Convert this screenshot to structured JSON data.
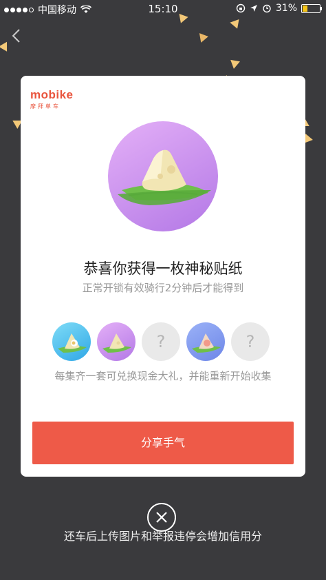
{
  "status_bar": {
    "carrier": "中国移动",
    "time": "15:10",
    "battery": "31%",
    "battery_level": 0.31
  },
  "card": {
    "logo": {
      "brand": "mobike",
      "subtitle": "摩拜单车"
    },
    "title": "恭喜你获得一枚神秘贴纸",
    "subtitle": "正常开锁有效骑行2分钟后才能得到",
    "stickers": [
      {
        "state": "collected",
        "color": "#3fb6ea"
      },
      {
        "state": "collected",
        "color": "#c48ced"
      },
      {
        "state": "unknown",
        "label": "?"
      },
      {
        "state": "collected",
        "color": "#7f97ee"
      },
      {
        "state": "unknown",
        "label": "?"
      }
    ],
    "hint": "每集齐一套可兑换现金大礼，并能重新开始收集",
    "share_button": "分享手气"
  },
  "footer": {
    "note": "还车后上传图片和举报违停会增加信用分"
  },
  "colors": {
    "accent": "#ee5a48",
    "brand": "#e9553e",
    "background": "#3a3a3d"
  }
}
